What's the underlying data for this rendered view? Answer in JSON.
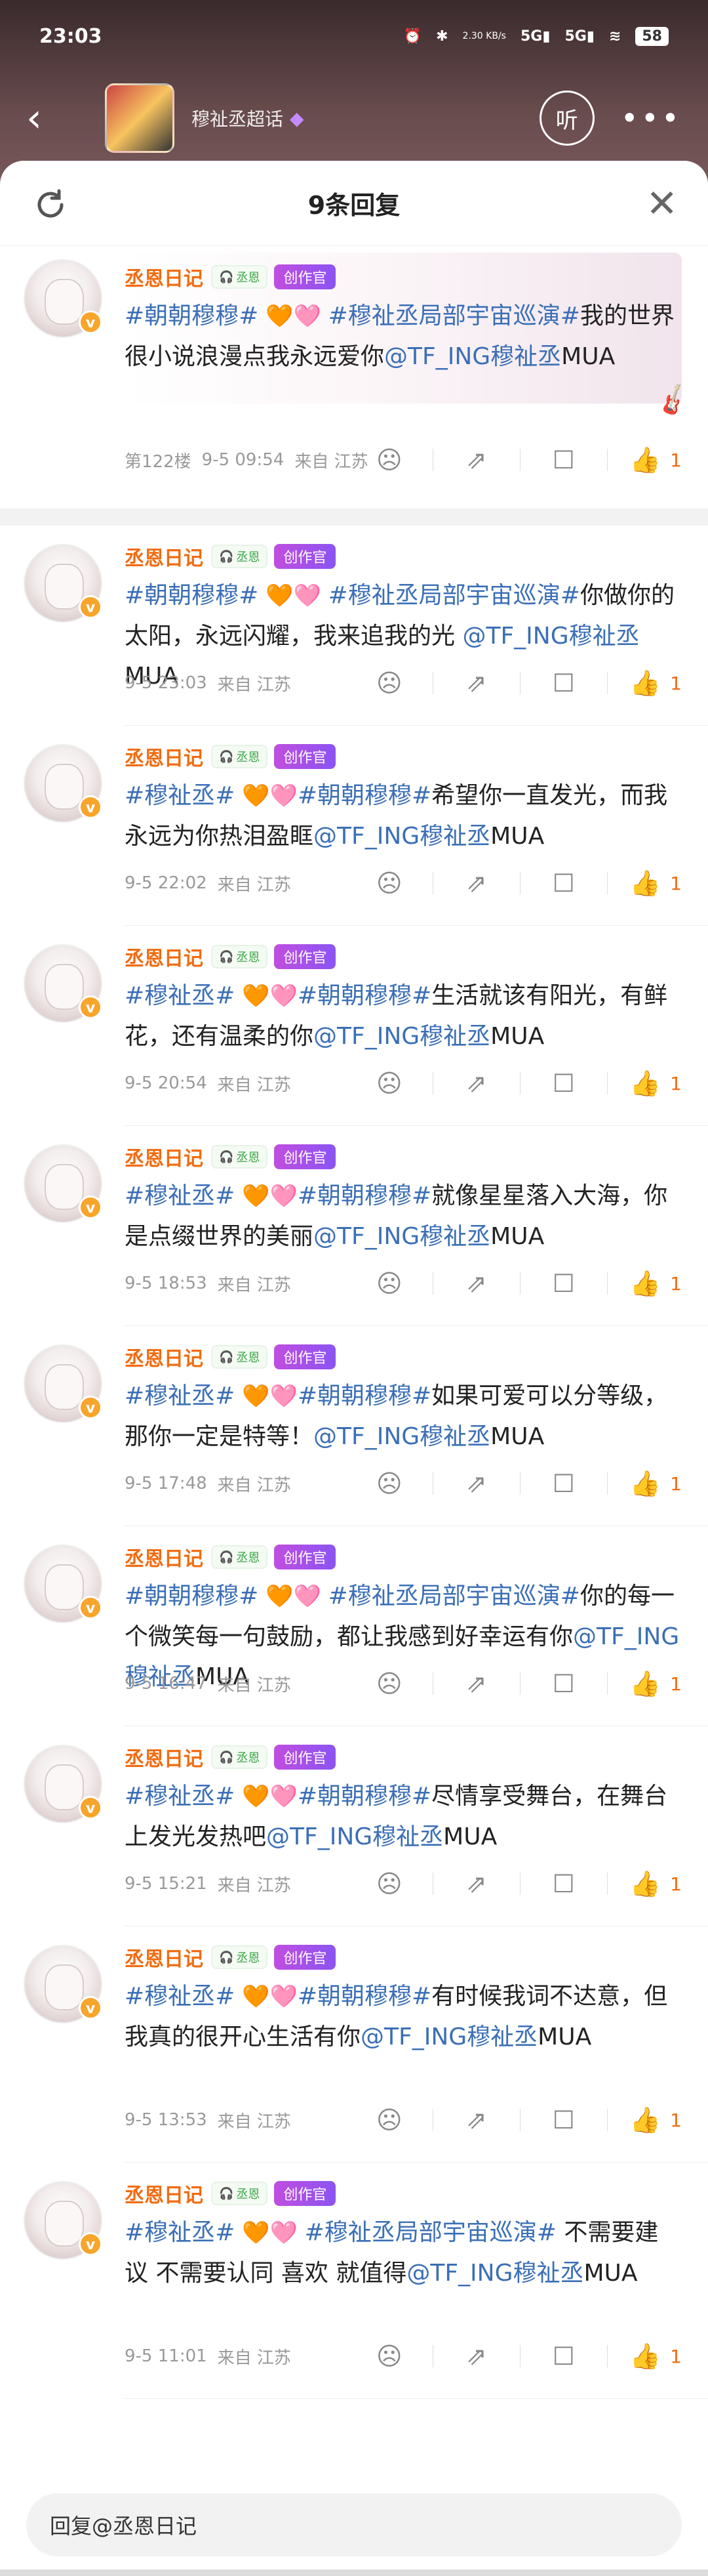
{
  "status": {
    "time": "23:03",
    "net_speed": "2.30 KB/s",
    "battery": "58"
  },
  "topic": {
    "name": "穆祉丞超话",
    "listen": "听"
  },
  "sheet": {
    "title": "9条回复"
  },
  "main": {
    "username": "丞恩日记",
    "fan_badge": "丞恩",
    "creator_badge": "创作官",
    "text_parts": [
      "#朝朝穆穆#",
      " 🧡🩷 ",
      "#穆祉丞局部宇宙巡演#",
      "我的世界很小说浪漫点我永远爱你",
      "@TF_ING穆祉丞",
      "MUA"
    ],
    "floor": "第122楼",
    "time": "9-5 09:54",
    "from": "来自 江苏",
    "likes": "1"
  },
  "comments": [
    {
      "username": "丞恩日记",
      "parts": [
        "#朝朝穆穆#",
        " 🧡🩷 ",
        "#穆祉丞局部宇宙巡演#",
        "你做你的太阳，永远闪耀，我来追我的光 ",
        "@TF_ING穆祉丞",
        "MUA"
      ],
      "time": "9-5 23:03",
      "from": "来自 江苏",
      "likes": "1"
    },
    {
      "username": "丞恩日记",
      "parts": [
        "#穆祉丞#",
        " 🧡🩷",
        "#朝朝穆穆#",
        "希望你一直发光，而我永远为你热泪盈眶",
        "@TF_ING穆祉丞",
        "MUA"
      ],
      "time": "9-5 22:02",
      "from": "来自 江苏",
      "likes": "1"
    },
    {
      "username": "丞恩日记",
      "parts": [
        "#穆祉丞#",
        " 🧡🩷",
        "#朝朝穆穆#",
        "生活就该有阳光，有鲜花，还有温柔的你",
        "@TF_ING穆祉丞",
        "MUA"
      ],
      "time": "9-5 20:54",
      "from": "来自 江苏",
      "likes": "1"
    },
    {
      "username": "丞恩日记",
      "parts": [
        "#穆祉丞#",
        " 🧡🩷",
        "#朝朝穆穆#",
        "就像星星落入大海，你是点缀世界的美丽",
        "@TF_ING穆祉丞",
        "MUA"
      ],
      "time": "9-5 18:53",
      "from": "来自 江苏",
      "likes": "1"
    },
    {
      "username": "丞恩日记",
      "parts": [
        "#穆祉丞#",
        " 🧡🩷",
        "#朝朝穆穆#",
        "如果可爱可以分等级，那你一定是特等！",
        "@TF_ING穆祉丞",
        "MUA"
      ],
      "time": "9-5 17:48",
      "from": "来自 江苏",
      "likes": "1"
    },
    {
      "username": "丞恩日记",
      "parts": [
        "#朝朝穆穆#",
        " 🧡🩷 ",
        "#穆祉丞局部宇宙巡演#",
        "你的每一个微笑每一句鼓励，都让我感到好幸运有你",
        "@TF_ING穆祉丞",
        "MUA"
      ],
      "time": "9-5 16:47",
      "from": "来自 江苏",
      "likes": "1"
    },
    {
      "username": "丞恩日记",
      "parts": [
        "#穆祉丞#",
        " 🧡🩷",
        "#朝朝穆穆#",
        "尽情享受舞台，在舞台上发光发热吧",
        "@TF_ING穆祉丞",
        "MUA"
      ],
      "time": "9-5 15:21",
      "from": "来自 江苏",
      "likes": "1"
    },
    {
      "username": "丞恩日记",
      "parts": [
        "#穆祉丞#",
        " 🧡🩷",
        "#朝朝穆穆#",
        "有时候我词不达意，但我真的很开心生活有你",
        "@TF_ING穆祉丞",
        "MUA"
      ],
      "time": "9-5 13:53",
      "from": "来自 江苏",
      "likes": "1"
    },
    {
      "username": "丞恩日记",
      "parts": [
        "#穆祉丞#",
        " 🧡🩷 ",
        "#穆祉丞局部宇宙巡演#",
        " 不需要建议 不需要认同 喜欢 就值得",
        "@TF_ING穆祉丞",
        "MUA"
      ],
      "time": "9-5 11:01",
      "from": "来自 江苏",
      "likes": "1"
    }
  ],
  "fan_badge": "丞恩",
  "creator_badge": "创作官",
  "reply": {
    "placeholder": "回复@丞恩日记"
  }
}
